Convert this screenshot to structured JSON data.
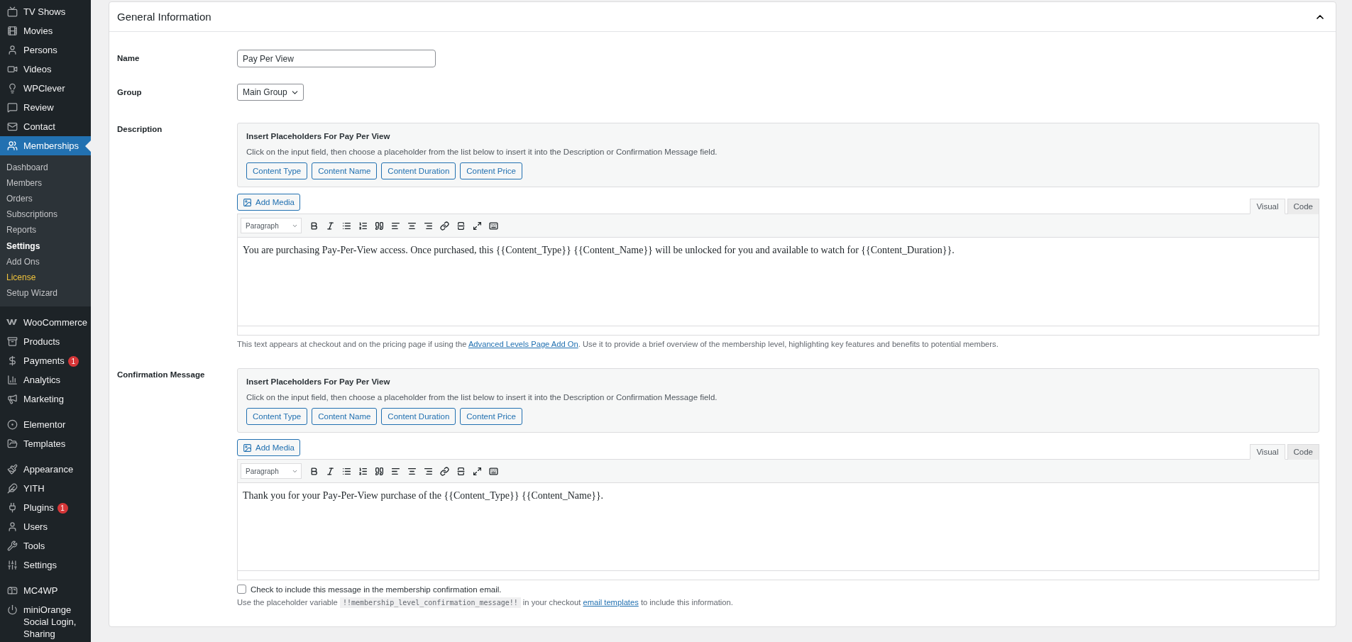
{
  "sidebar": {
    "groups": [
      [
        {
          "label": "TV Shows",
          "selected": false
        },
        {
          "label": "Movies",
          "selected": false
        },
        {
          "label": "Persons",
          "selected": false
        },
        {
          "label": "Videos",
          "selected": false
        },
        {
          "label": "WPClever",
          "selected": false
        },
        {
          "label": "Review",
          "selected": false
        },
        {
          "label": "Contact",
          "selected": false
        },
        {
          "label": "Memberships",
          "selected": true,
          "children": [
            {
              "label": "Dashboard",
              "selected": false,
              "color": "#c3c4c7"
            },
            {
              "label": "Members",
              "selected": false,
              "color": "#c3c4c7"
            },
            {
              "label": "Orders",
              "selected": false,
              "color": "#c3c4c7"
            },
            {
              "label": "Subscriptions",
              "selected": false,
              "color": "#c3c4c7"
            },
            {
              "label": "Reports",
              "selected": false,
              "color": "#c3c4c7"
            },
            {
              "label": "Settings",
              "selected": true,
              "color": "#ffffff"
            },
            {
              "label": "Add Ons",
              "selected": false,
              "color": "#c3c4c7"
            },
            {
              "label": "License",
              "selected": false,
              "color": "#f0c33c"
            },
            {
              "label": "Setup Wizard",
              "selected": false,
              "color": "#c3c4c7"
            }
          ]
        }
      ],
      [
        {
          "label": "WooCommerce",
          "selected": false
        },
        {
          "label": "Products",
          "selected": false
        },
        {
          "label": "Payments",
          "selected": false,
          "badge": "1"
        },
        {
          "label": "Analytics",
          "selected": false
        },
        {
          "label": "Marketing",
          "selected": false
        }
      ],
      [
        {
          "label": "Elementor",
          "selected": false
        },
        {
          "label": "Templates",
          "selected": false
        }
      ],
      [
        {
          "label": "Appearance",
          "selected": false
        },
        {
          "label": "YITH",
          "selected": false
        },
        {
          "label": "Plugins",
          "selected": false,
          "badge": "1"
        },
        {
          "label": "Users",
          "selected": false
        },
        {
          "label": "Tools",
          "selected": false
        },
        {
          "label": "Settings",
          "selected": false
        }
      ],
      [
        {
          "label": "MC4WP",
          "selected": false
        },
        {
          "label": "miniOrange Social Login, Sharing",
          "selected": false
        }
      ]
    ]
  },
  "panel": {
    "title": "General Information",
    "expanded": true,
    "fields": [
      {
        "kind": "text",
        "label": "Name",
        "value": "Pay Per View"
      },
      {
        "kind": "select",
        "label": "Group",
        "value": "Main Group"
      },
      {
        "kind": "editor",
        "label": "Description",
        "placeholders": {
          "title": "Insert Placeholders For Pay Per View",
          "hint": "Click on the input field, then choose a placeholder from the list below to insert it into the Description or Confirmation Message field.",
          "buttons": [
            "Content Type",
            "Content Name",
            "Content Duration",
            "Content Price"
          ]
        },
        "add_media": "Add Media",
        "tabs": [
          {
            "label": "Visual",
            "selected": true
          },
          {
            "label": "Code",
            "selected": false
          }
        ],
        "format": "Paragraph",
        "content": "You are purchasing Pay-Per-View access. Once purchased, this {{Content_Type}} {{Content_Name}} will be unlocked for you and available to watch for {{Content_Duration}}.",
        "help": {
          "before": "This text appears at checkout and on the pricing page if using the ",
          "link": "Advanced Levels Page Add On",
          "after": ". Use it to provide a brief overview of the membership level, highlighting key features and benefits to potential members."
        }
      },
      {
        "kind": "editor",
        "label": "Confirmation Message",
        "placeholders": {
          "title": "Insert Placeholders For Pay Per View",
          "hint": "Click on the input field, then choose a placeholder from the list below to insert it into the Description or Confirmation Message field.",
          "buttons": [
            "Content Type",
            "Content Name",
            "Content Duration",
            "Content Price"
          ]
        },
        "add_media": "Add Media",
        "tabs": [
          {
            "label": "Visual",
            "selected": true
          },
          {
            "label": "Code",
            "selected": false
          }
        ],
        "format": "Paragraph",
        "content": "Thank you for your Pay-Per-View purchase of the {{Content_Type}} {{Content_Name}}.",
        "checkbox": {
          "label": "Check to include this message in the membership confirmation email.",
          "checked": false
        },
        "help": {
          "before": "Use the placeholder variable ",
          "code": "!!membership_level_confirmation_message!!",
          "middle": " in your checkout ",
          "link": "email templates",
          "after": " to include this information."
        }
      }
    ]
  }
}
